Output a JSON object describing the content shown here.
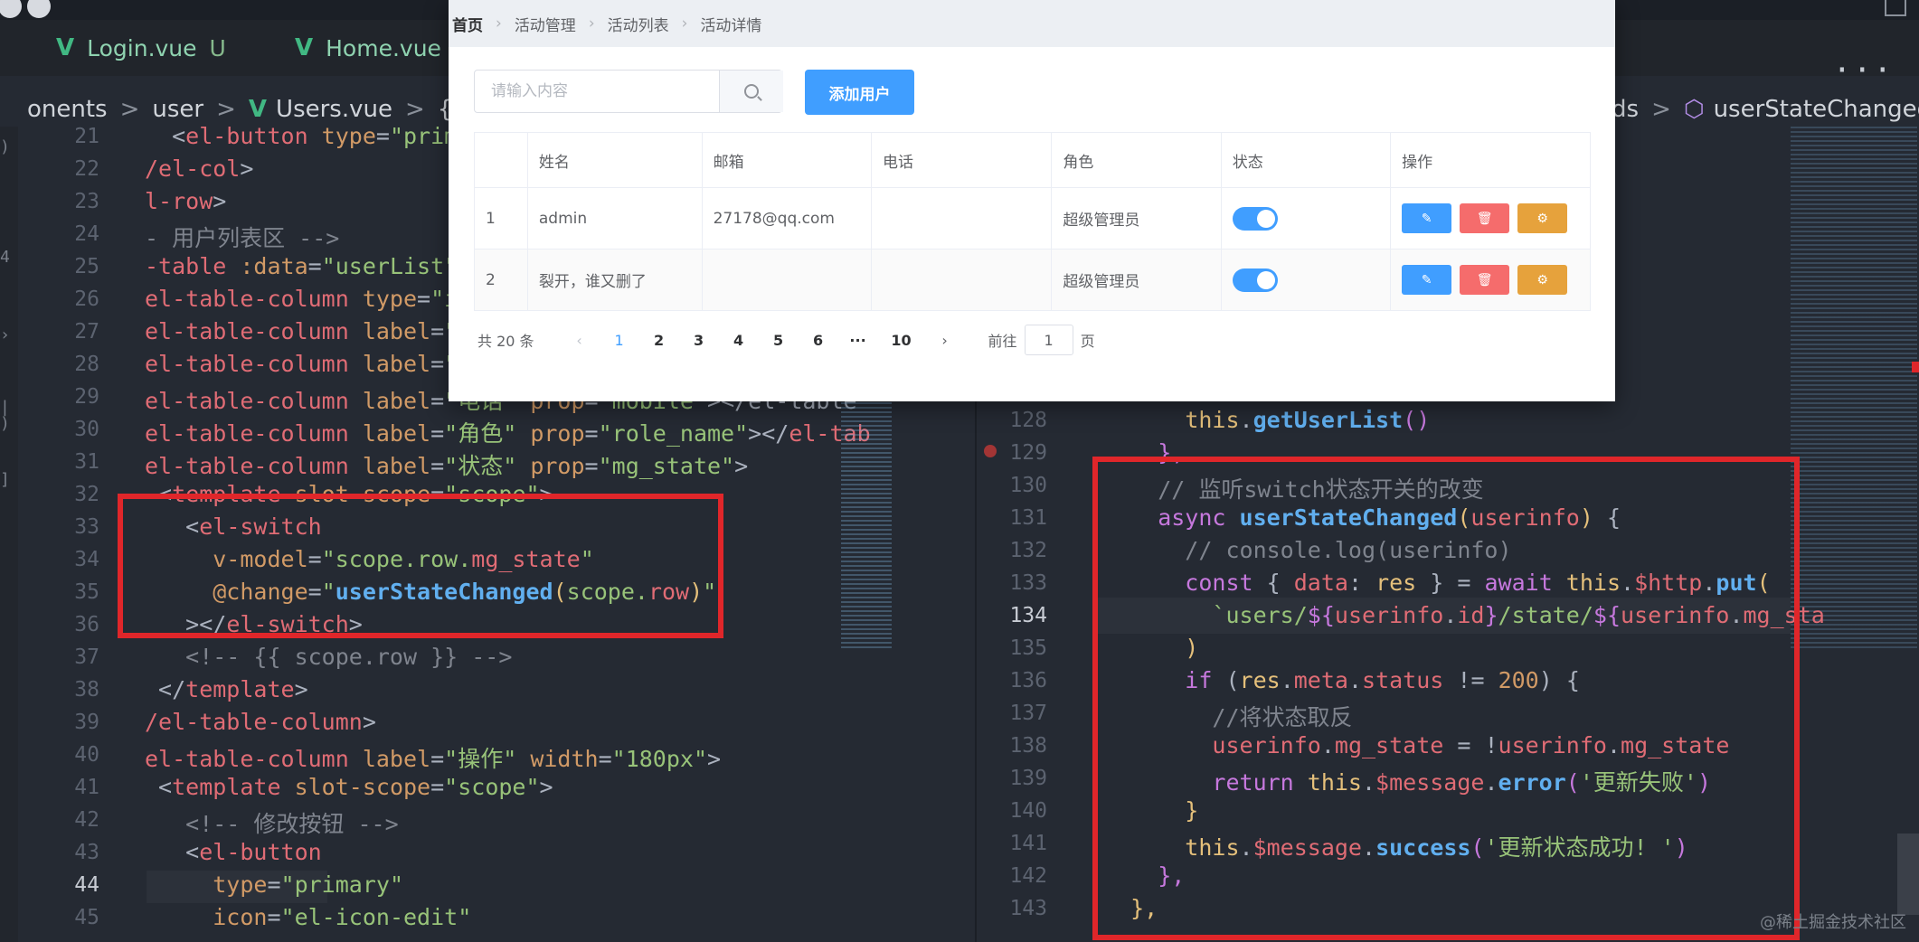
{
  "editor": {
    "tabs": [
      {
        "label": "Login.vue",
        "badge": "U"
      },
      {
        "label": "Home.vue",
        "badge": ""
      }
    ],
    "breadcrumb_left": [
      "onents",
      "user",
      "Users.vue",
      "{} \"U"
    ],
    "breadcrumb_right": [
      "ds",
      "userStateChanged"
    ],
    "left_pane": [
      {
        "n": "21",
        "tokens": [
          [
            "t-punc",
            "  <"
          ],
          [
            "t-tag",
            "el-button"
          ],
          [
            "t-attr",
            " type"
          ],
          [
            "t-punc",
            "="
          ],
          [
            "t-str",
            "\"prima"
          ]
        ]
      },
      {
        "n": "22",
        "tokens": [
          [
            "t-tag",
            "/el-col"
          ],
          [
            "t-punc",
            ">"
          ]
        ]
      },
      {
        "n": "23",
        "tokens": [
          [
            "t-tag",
            "l-row"
          ],
          [
            "t-punc",
            ">"
          ]
        ]
      },
      {
        "n": "24",
        "tokens": [
          [
            "t-cmt",
            "- 用户列表区 -->"
          ]
        ]
      },
      {
        "n": "25",
        "tokens": [
          [
            "t-tag",
            "-table"
          ],
          [
            "t-attr",
            " :data"
          ],
          [
            "t-punc",
            "="
          ],
          [
            "t-str",
            "\"userList\""
          ]
        ]
      },
      {
        "n": "26",
        "tokens": [
          [
            "t-tag",
            "el-table-column"
          ],
          [
            "t-attr",
            " type"
          ],
          [
            "t-punc",
            "="
          ],
          [
            "t-str",
            "\"i"
          ]
        ]
      },
      {
        "n": "27",
        "tokens": [
          [
            "t-tag",
            "el-table-column"
          ],
          [
            "t-attr",
            " label"
          ],
          [
            "t-punc",
            "="
          ],
          [
            "t-str",
            "\""
          ]
        ]
      },
      {
        "n": "28",
        "tokens": [
          [
            "t-tag",
            "el-table-column"
          ],
          [
            "t-attr",
            " label"
          ],
          [
            "t-punc",
            "="
          ],
          [
            "t-str",
            "\""
          ]
        ]
      },
      {
        "n": "29",
        "tokens": [
          [
            "t-tag",
            "el-table-column"
          ],
          [
            "t-attr",
            " label"
          ],
          [
            "t-punc",
            "="
          ],
          [
            "t-str",
            "\"电话\""
          ],
          [
            "t-attr",
            " prop"
          ],
          [
            "t-punc",
            "="
          ],
          [
            "t-str",
            "\"mobile\""
          ],
          [
            "t-punc",
            "></el-table"
          ]
        ]
      },
      {
        "n": "30",
        "tokens": [
          [
            "t-tag",
            "el-table-column"
          ],
          [
            "t-attr",
            " label"
          ],
          [
            "t-punc",
            "="
          ],
          [
            "t-str",
            "\"角色\""
          ],
          [
            "t-attr",
            " prop"
          ],
          [
            "t-punc",
            "="
          ],
          [
            "t-str",
            "\"role_name\""
          ],
          [
            "t-punc",
            "></"
          ],
          [
            "t-tag",
            "el-tab"
          ]
        ]
      },
      {
        "n": "31",
        "tokens": [
          [
            "t-tag",
            "el-table-column"
          ],
          [
            "t-attr",
            " label"
          ],
          [
            "t-punc",
            "="
          ],
          [
            "t-str",
            "\"状态\""
          ],
          [
            "t-attr",
            " prop"
          ],
          [
            "t-punc",
            "="
          ],
          [
            "t-str",
            "\"mg_state\""
          ],
          [
            "t-punc",
            ">"
          ]
        ]
      },
      {
        "n": "32",
        "tokens": [
          [
            "t-punc",
            " <"
          ],
          [
            "t-tag",
            "template"
          ],
          [
            "t-attr",
            " slot-scope"
          ],
          [
            "t-punc",
            "="
          ],
          [
            "t-str",
            "\"scope\""
          ],
          [
            "t-punc",
            ">"
          ]
        ]
      },
      {
        "n": "33",
        "tokens": [
          [
            "t-punc",
            "   <"
          ],
          [
            "t-tag",
            "el-switch"
          ]
        ]
      },
      {
        "n": "34",
        "tokens": [
          [
            "t-attr",
            "     v-model"
          ],
          [
            "t-punc",
            "="
          ],
          [
            "t-str",
            "\"scope.row."
          ],
          [
            "t-var",
            "mg_state"
          ],
          [
            "t-str",
            "\""
          ]
        ]
      },
      {
        "n": "35",
        "tokens": [
          [
            "t-attr",
            "     @change"
          ],
          [
            "t-punc",
            "="
          ],
          [
            "t-str",
            "\""
          ],
          [
            "t-fn",
            "userStateChanged"
          ],
          [
            "t-brk",
            "("
          ],
          [
            "t-str",
            "scope."
          ],
          [
            "t-var",
            "row"
          ],
          [
            "t-brk",
            ")"
          ],
          [
            "t-str",
            "\""
          ]
        ]
      },
      {
        "n": "36",
        "tokens": [
          [
            "t-punc",
            "   ></"
          ],
          [
            "t-tag",
            "el-switch"
          ],
          [
            "t-punc",
            ">"
          ]
        ]
      },
      {
        "n": "37",
        "tokens": [
          [
            "t-cmt",
            "   <!-- {{ scope.row }} -->"
          ]
        ]
      },
      {
        "n": "38",
        "tokens": [
          [
            "t-punc",
            " </"
          ],
          [
            "t-tag",
            "template"
          ],
          [
            "t-punc",
            ">"
          ]
        ]
      },
      {
        "n": "39",
        "tokens": [
          [
            "t-tag",
            "/el-table-column"
          ],
          [
            "t-punc",
            ">"
          ]
        ]
      },
      {
        "n": "40",
        "tokens": [
          [
            "t-tag",
            "el-table-column"
          ],
          [
            "t-attr",
            " label"
          ],
          [
            "t-punc",
            "="
          ],
          [
            "t-str",
            "\"操作\""
          ],
          [
            "t-attr",
            " width"
          ],
          [
            "t-punc",
            "="
          ],
          [
            "t-str",
            "\"180px\""
          ],
          [
            "t-punc",
            ">"
          ]
        ]
      },
      {
        "n": "41",
        "tokens": [
          [
            "t-punc",
            " <"
          ],
          [
            "t-tag",
            "template"
          ],
          [
            "t-attr",
            " slot-scope"
          ],
          [
            "t-punc",
            "="
          ],
          [
            "t-str",
            "\"scope\""
          ],
          [
            "t-punc",
            ">"
          ]
        ]
      },
      {
        "n": "42",
        "tokens": [
          [
            "t-cmt",
            "   <!-- 修改按钮 -->"
          ]
        ]
      },
      {
        "n": "43",
        "tokens": [
          [
            "t-punc",
            "   <"
          ],
          [
            "t-tag",
            "el-button"
          ]
        ]
      },
      {
        "n": "44",
        "active": true,
        "tokens": [
          [
            "t-attr",
            "     type"
          ],
          [
            "t-punc",
            "="
          ],
          [
            "t-str",
            "\"primary\""
          ]
        ]
      },
      {
        "n": "45",
        "tokens": [
          [
            "t-attr",
            "     icon"
          ],
          [
            "t-punc",
            "="
          ],
          [
            "t-str",
            "\"el-icon-edit\""
          ]
        ]
      }
    ],
    "right_pane": [
      {
        "n": "128",
        "tokens": [
          [
            "t-punc",
            "      "
          ],
          [
            "t-brk",
            "this"
          ],
          [
            "t-punc",
            "."
          ],
          [
            "t-fn",
            "getUserList"
          ],
          [
            "t-kw",
            "()"
          ]
        ]
      },
      {
        "n": "129",
        "tokens": [
          [
            "t-punc",
            "    "
          ],
          [
            "t-kw",
            "},"
          ]
        ]
      },
      {
        "n": "130",
        "tokens": [
          [
            "t-cmt",
            "    // 监听switch状态开关的改变"
          ]
        ]
      },
      {
        "n": "131",
        "tokens": [
          [
            "t-kw",
            "    async "
          ],
          [
            "t-fn",
            "userStateChanged"
          ],
          [
            "t-brk",
            "("
          ],
          [
            "t-var",
            "userinfo"
          ],
          [
            "t-brk",
            ")"
          ],
          [
            "t-punc",
            " {"
          ]
        ]
      },
      {
        "n": "132",
        "tokens": [
          [
            "t-cmt",
            "      // console.log(userinfo)"
          ]
        ]
      },
      {
        "n": "133",
        "tokens": [
          [
            "t-kw",
            "      const"
          ],
          [
            "t-punc",
            " { "
          ],
          [
            "t-var",
            "data"
          ],
          [
            "t-punc",
            ": "
          ],
          [
            "t-brk",
            "res"
          ],
          [
            "t-punc",
            " } = "
          ],
          [
            "t-kw",
            "await"
          ],
          [
            "t-brk",
            " this"
          ],
          [
            "t-punc",
            "."
          ],
          [
            "t-var",
            "$http"
          ],
          [
            "t-punc",
            "."
          ],
          [
            "t-fn",
            "put"
          ],
          [
            "t-brk",
            "("
          ]
        ]
      },
      {
        "n": "134",
        "active": true,
        "tokens": [
          [
            "t-str",
            "        `users/"
          ],
          [
            "t-kw",
            "${"
          ],
          [
            "t-var",
            "userinfo"
          ],
          [
            "t-punc",
            "."
          ],
          [
            "t-var",
            "id"
          ],
          [
            "t-kw",
            "}"
          ],
          [
            "t-str",
            "/state/"
          ],
          [
            "t-kw",
            "${"
          ],
          [
            "t-var",
            "userinfo"
          ],
          [
            "t-punc",
            "."
          ],
          [
            "t-var",
            "mg_sta"
          ]
        ]
      },
      {
        "n": "135",
        "tokens": [
          [
            "t-brk",
            "      )"
          ]
        ]
      },
      {
        "n": "136",
        "tokens": [
          [
            "t-kw",
            "      if"
          ],
          [
            "t-punc",
            " ("
          ],
          [
            "t-brk",
            "res"
          ],
          [
            "t-punc",
            "."
          ],
          [
            "t-var",
            "meta"
          ],
          [
            "t-punc",
            "."
          ],
          [
            "t-var",
            "status"
          ],
          [
            "t-punc",
            " != "
          ],
          [
            "t-num",
            "200"
          ],
          [
            "t-punc",
            ") {"
          ]
        ]
      },
      {
        "n": "137",
        "tokens": [
          [
            "t-cmt",
            "        //将状态取反"
          ]
        ]
      },
      {
        "n": "138",
        "tokens": [
          [
            "t-var",
            "        userinfo"
          ],
          [
            "t-punc",
            "."
          ],
          [
            "t-var",
            "mg_state"
          ],
          [
            "t-punc",
            " = !"
          ],
          [
            "t-var",
            "userinfo"
          ],
          [
            "t-punc",
            "."
          ],
          [
            "t-var",
            "mg_state"
          ]
        ]
      },
      {
        "n": "139",
        "tokens": [
          [
            "t-kw",
            "        return"
          ],
          [
            "t-brk",
            " this"
          ],
          [
            "t-punc",
            "."
          ],
          [
            "t-var",
            "$message"
          ],
          [
            "t-punc",
            "."
          ],
          [
            "t-fn",
            "error"
          ],
          [
            "t-kw",
            "("
          ],
          [
            "t-str",
            "'更新失败'"
          ],
          [
            "t-kw",
            ")"
          ]
        ]
      },
      {
        "n": "140",
        "tokens": [
          [
            "t-brk",
            "      }"
          ]
        ]
      },
      {
        "n": "141",
        "tokens": [
          [
            "t-brk",
            "      this"
          ],
          [
            "t-punc",
            "."
          ],
          [
            "t-var",
            "$message"
          ],
          [
            "t-punc",
            "."
          ],
          [
            "t-fn",
            "success"
          ],
          [
            "t-kw",
            "("
          ],
          [
            "t-str",
            "'更新状态成功! '"
          ],
          [
            "t-kw",
            ")"
          ]
        ]
      },
      {
        "n": "142",
        "tokens": [
          [
            "t-kw",
            "    },"
          ]
        ]
      },
      {
        "n": "143",
        "tokens": [
          [
            "t-brk",
            "  },"
          ]
        ]
      }
    ],
    "watermark": "@稀土掘金技术社区"
  },
  "browser": {
    "breadcrumb": [
      "首页",
      "活动管理",
      "活动列表",
      "活动详情"
    ],
    "search_placeholder": "请输入内容",
    "add_user_label": "添加用户",
    "columns": [
      "",
      "姓名",
      "邮箱",
      "电话",
      "角色",
      "状态",
      "操作"
    ],
    "rows": [
      {
        "index": "1",
        "name": "admin",
        "email": "27178@qq.com",
        "phone": "",
        "role": "超级管理员",
        "state_on": true
      },
      {
        "index": "2",
        "name": "裂开，谁又删了",
        "email": "",
        "phone": "",
        "role": "超级管理员",
        "state_on": true
      }
    ],
    "pagination": {
      "total_label": "共 20 条",
      "pages": [
        "1",
        "2",
        "3",
        "4",
        "5",
        "6",
        "···",
        "10"
      ],
      "current": "1",
      "goto_prefix": "前往",
      "goto_value": "1",
      "goto_suffix": "页"
    }
  },
  "colors": {
    "accent": "#409eff",
    "danger": "#f56c6c",
    "warning": "#e6a23c",
    "highlight_box": "#e0262a"
  }
}
